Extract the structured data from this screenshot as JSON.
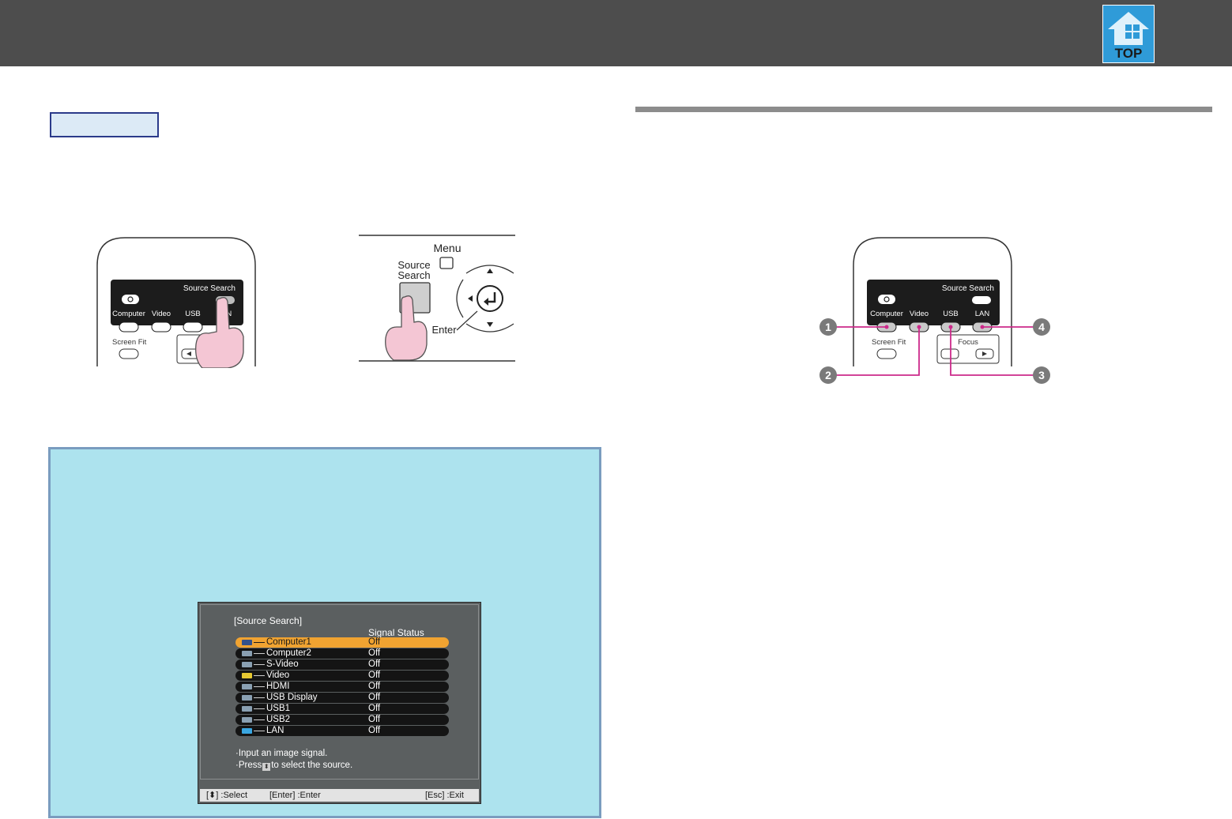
{
  "header": {
    "top_button_label": "TOP"
  },
  "remote_left": {
    "source_search_label": "Source Search",
    "buttons": [
      "Computer",
      "Video",
      "USB",
      "LAN"
    ],
    "screen_fit_label": "Screen Fit"
  },
  "control_panel": {
    "menu_label": "Menu",
    "source_label": "Source",
    "search_label": "Search",
    "enter_label": "Enter"
  },
  "remote_right": {
    "source_search_label": "Source Search",
    "buttons": [
      "Computer",
      "Video",
      "USB",
      "LAN"
    ],
    "screen_fit_label": "Screen Fit",
    "focus_label": "Focus",
    "callouts": [
      "1",
      "2",
      "3",
      "4"
    ]
  },
  "osd": {
    "title": "[Source Search]",
    "column_header": "Signal Status",
    "sources": [
      {
        "name": "Computer1",
        "status": "Off",
        "selected": true
      },
      {
        "name": "Computer2",
        "status": "Off"
      },
      {
        "name": "S-Video",
        "status": "Off"
      },
      {
        "name": "Video",
        "status": "Off"
      },
      {
        "name": "HDMI",
        "status": "Off"
      },
      {
        "name": "USB Display",
        "status": "Off"
      },
      {
        "name": "USB1",
        "status": "Off"
      },
      {
        "name": "USB2",
        "status": "Off"
      },
      {
        "name": "LAN",
        "status": "Off"
      }
    ],
    "help_lines": [
      "·Input an image signal.",
      "·Press",
      "to select the source."
    ],
    "footer": {
      "select": "[⬍] :Select",
      "enter": "[Enter] :Enter",
      "exit": "[Esc] :Exit"
    }
  }
}
